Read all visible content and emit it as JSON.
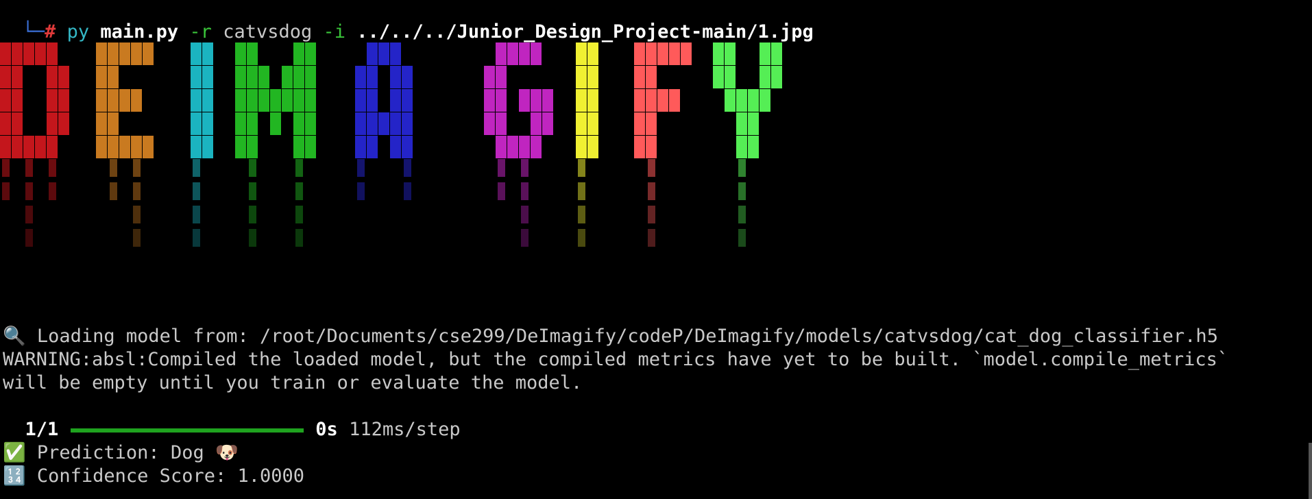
{
  "prompt": {
    "branch": "└─",
    "symbol": "#",
    "cmd": "py",
    "script": "main.py",
    "flag_r": "-r",
    "model": "catvsdog",
    "flag_i": "-i",
    "path": "../../../Junior_Design_Project-main/1.jpg"
  },
  "banner": {
    "text": "DEIMAGIFY",
    "colors": [
      "#c4161c",
      "#c97a20",
      "#1bb4c0",
      "#22b622",
      "#22b622",
      "#2424c8",
      "#c025c0",
      "#f0f032",
      "#ff5a5a",
      "#55ee55"
    ]
  },
  "output": {
    "loading_icon": "magnifier-icon",
    "loading": "🔍 Loading model from: /root/Documents/cse299/DeImagify/codeP/DeImagify/models/catvsdog/cat_dog_classifier.h5",
    "warning1": "WARNING:absl:Compiled the loaded model, but the compiled metrics have yet to be built. `model.compile_metrics`",
    "warning2": "will be empty until you train or evaluate the model.",
    "progress_count": "1/1",
    "progress_fraction": 1.0,
    "progress_time": "0s",
    "progress_rate": "112ms/step",
    "prediction": "✅ Prediction: Dog 🐶",
    "confidence": "🔢 Confidence Score: 1.0000"
  }
}
